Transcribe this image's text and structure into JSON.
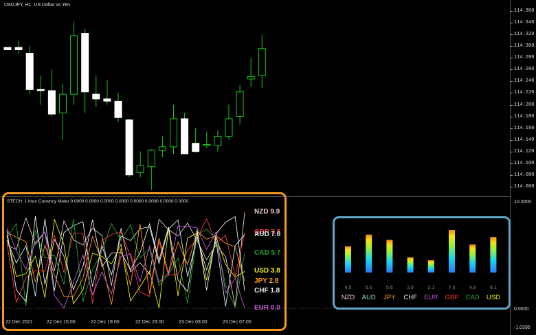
{
  "chart": {
    "title": "USDJPY, H1:  US Dollar vs Yen",
    "price_labels": [
      "114.360",
      "114.340",
      "114.320",
      "114.300",
      "114.280",
      "114.260",
      "114.240",
      "114.220",
      "114.200",
      "114.180",
      "114.160",
      "114.140",
      "114.120",
      "114.100",
      "114.080",
      "114.060"
    ],
    "price_range": [
      114.048,
      114.372
    ]
  },
  "candles": [
    {
      "o": 114.298,
      "h": 114.298,
      "l": 114.294,
      "c": 114.294
    },
    {
      "o": 114.298,
      "h": 114.31,
      "l": 114.286,
      "c": 114.294
    },
    {
      "o": 114.288,
      "h": 114.3,
      "l": 114.218,
      "c": 114.226
    },
    {
      "o": 114.226,
      "h": 114.25,
      "l": 114.2,
      "c": 114.224
    },
    {
      "o": 114.224,
      "h": 114.26,
      "l": 114.18,
      "c": 114.184
    },
    {
      "o": 114.186,
      "h": 114.236,
      "l": 114.14,
      "c": 114.218
    },
    {
      "o": 114.218,
      "h": 114.342,
      "l": 114.2,
      "c": 114.318
    },
    {
      "o": 114.322,
      "h": 114.33,
      "l": 114.186,
      "c": 114.222
    },
    {
      "o": 114.218,
      "h": 114.25,
      "l": 114.196,
      "c": 114.21
    },
    {
      "o": 114.21,
      "h": 114.242,
      "l": 114.2,
      "c": 114.206
    },
    {
      "o": 114.206,
      "h": 114.22,
      "l": 114.17,
      "c": 114.178
    },
    {
      "o": 114.174,
      "h": 114.176,
      "l": 114.076,
      "c": 114.08
    },
    {
      "o": 114.084,
      "h": 114.12,
      "l": 114.076,
      "c": 114.096
    },
    {
      "o": 114.094,
      "h": 114.124,
      "l": 114.054,
      "c": 114.122
    },
    {
      "o": 114.122,
      "h": 114.146,
      "l": 114.11,
      "c": 114.128
    },
    {
      "o": 114.128,
      "h": 114.2,
      "l": 114.116,
      "c": 114.176
    },
    {
      "o": 114.176,
      "h": 114.186,
      "l": 114.116,
      "c": 114.116
    },
    {
      "o": 114.134,
      "h": 114.16,
      "l": 114.118,
      "c": 114.12
    },
    {
      "o": 114.132,
      "h": 114.154,
      "l": 114.126,
      "c": 114.132
    },
    {
      "o": 114.13,
      "h": 114.156,
      "l": 114.12,
      "c": 114.146
    },
    {
      "o": 114.146,
      "h": 114.2,
      "l": 114.14,
      "c": 114.176
    },
    {
      "o": 114.18,
      "h": 114.234,
      "l": 114.166,
      "c": 114.222
    },
    {
      "o": 114.244,
      "h": 114.28,
      "l": 114.23,
      "c": 114.248
    },
    {
      "o": 114.25,
      "h": 114.32,
      "l": 114.228,
      "c": 114.296
    }
  ],
  "indicator": {
    "label": "STECH: 1 hour Currency Meter 0.0000 0.0000 0.0000 0.0000 0.0000 0.0000 0.0000 0.0000",
    "axis_top": "10.0000",
    "axis_bottom": "-1.0395",
    "axis_zero": "0.0000",
    "time_labels": [
      "22 Dec 2021",
      "22 Dec 15:00",
      "22 Dec 19:00",
      "22 Dec 23:00",
      "23 Dec 03:00",
      "23 Dec 07:00"
    ],
    "currencies": [
      {
        "name": "NZD",
        "value": "9.9",
        "color": "#f0c8c8"
      },
      {
        "name": "GBP",
        "value": "7.8",
        "color": "#ff3b3b"
      },
      {
        "name": "AUD",
        "value": "7.6",
        "color": "#c8f0f0"
      },
      {
        "name": "CAD",
        "value": "5.7",
        "color": "#29a329"
      },
      {
        "name": "USD",
        "value": "3.8",
        "color": "#f2f20c"
      },
      {
        "name": "JPY",
        "value": "2.8",
        "color": "#ff9a1a"
      },
      {
        "name": "CHF",
        "value": "1.8",
        "color": "#f0f0f0"
      },
      {
        "name": "EUR",
        "value": "0.0",
        "color": "#c25ad8"
      }
    ]
  },
  "bars": [
    {
      "name": "NZD",
      "value": 4.5,
      "label": "4.5",
      "color": "#f0c8c8"
    },
    {
      "name": "AUD",
      "value": 6.5,
      "label": "6.5",
      "color": "#9ad8d8"
    },
    {
      "name": "JPY",
      "value": 5.6,
      "label": "5.6",
      "color": "#ff9a1a"
    },
    {
      "name": "CHF",
      "value": 2.6,
      "label": "2.6",
      "color": "#f0f0f0"
    },
    {
      "name": "EUR",
      "value": 2.1,
      "label": "2.1",
      "color": "#c25ad8"
    },
    {
      "name": "GBP",
      "value": 7.3,
      "label": "7.3",
      "color": "#ff2b2b"
    },
    {
      "name": "CAD",
      "value": 4.8,
      "label": "4.8",
      "color": "#29a329"
    },
    {
      "name": "USD",
      "value": 6.1,
      "label": "6.1",
      "color": "#f2f20c"
    }
  ]
}
